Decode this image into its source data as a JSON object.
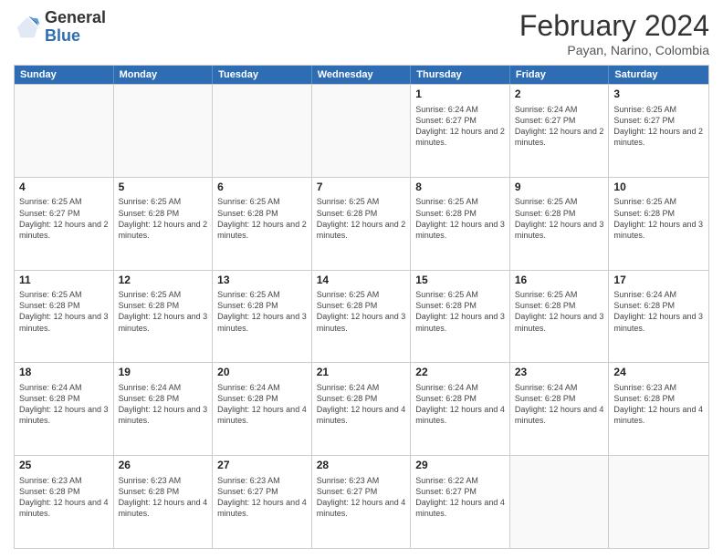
{
  "header": {
    "logo": {
      "line1": "General",
      "line2": "Blue"
    },
    "title": "February 2024",
    "location": "Payan, Narino, Colombia"
  },
  "days_of_week": [
    "Sunday",
    "Monday",
    "Tuesday",
    "Wednesday",
    "Thursday",
    "Friday",
    "Saturday"
  ],
  "weeks": [
    [
      {
        "day": "",
        "empty": true
      },
      {
        "day": "",
        "empty": true
      },
      {
        "day": "",
        "empty": true
      },
      {
        "day": "",
        "empty": true
      },
      {
        "day": "1",
        "sunrise": "Sunrise: 6:24 AM",
        "sunset": "Sunset: 6:27 PM",
        "daylight": "Daylight: 12 hours and 2 minutes."
      },
      {
        "day": "2",
        "sunrise": "Sunrise: 6:24 AM",
        "sunset": "Sunset: 6:27 PM",
        "daylight": "Daylight: 12 hours and 2 minutes."
      },
      {
        "day": "3",
        "sunrise": "Sunrise: 6:25 AM",
        "sunset": "Sunset: 6:27 PM",
        "daylight": "Daylight: 12 hours and 2 minutes."
      }
    ],
    [
      {
        "day": "4",
        "sunrise": "Sunrise: 6:25 AM",
        "sunset": "Sunset: 6:27 PM",
        "daylight": "Daylight: 12 hours and 2 minutes."
      },
      {
        "day": "5",
        "sunrise": "Sunrise: 6:25 AM",
        "sunset": "Sunset: 6:28 PM",
        "daylight": "Daylight: 12 hours and 2 minutes."
      },
      {
        "day": "6",
        "sunrise": "Sunrise: 6:25 AM",
        "sunset": "Sunset: 6:28 PM",
        "daylight": "Daylight: 12 hours and 2 minutes."
      },
      {
        "day": "7",
        "sunrise": "Sunrise: 6:25 AM",
        "sunset": "Sunset: 6:28 PM",
        "daylight": "Daylight: 12 hours and 2 minutes."
      },
      {
        "day": "8",
        "sunrise": "Sunrise: 6:25 AM",
        "sunset": "Sunset: 6:28 PM",
        "daylight": "Daylight: 12 hours and 3 minutes."
      },
      {
        "day": "9",
        "sunrise": "Sunrise: 6:25 AM",
        "sunset": "Sunset: 6:28 PM",
        "daylight": "Daylight: 12 hours and 3 minutes."
      },
      {
        "day": "10",
        "sunrise": "Sunrise: 6:25 AM",
        "sunset": "Sunset: 6:28 PM",
        "daylight": "Daylight: 12 hours and 3 minutes."
      }
    ],
    [
      {
        "day": "11",
        "sunrise": "Sunrise: 6:25 AM",
        "sunset": "Sunset: 6:28 PM",
        "daylight": "Daylight: 12 hours and 3 minutes."
      },
      {
        "day": "12",
        "sunrise": "Sunrise: 6:25 AM",
        "sunset": "Sunset: 6:28 PM",
        "daylight": "Daylight: 12 hours and 3 minutes."
      },
      {
        "day": "13",
        "sunrise": "Sunrise: 6:25 AM",
        "sunset": "Sunset: 6:28 PM",
        "daylight": "Daylight: 12 hours and 3 minutes."
      },
      {
        "day": "14",
        "sunrise": "Sunrise: 6:25 AM",
        "sunset": "Sunset: 6:28 PM",
        "daylight": "Daylight: 12 hours and 3 minutes."
      },
      {
        "day": "15",
        "sunrise": "Sunrise: 6:25 AM",
        "sunset": "Sunset: 6:28 PM",
        "daylight": "Daylight: 12 hours and 3 minutes."
      },
      {
        "day": "16",
        "sunrise": "Sunrise: 6:25 AM",
        "sunset": "Sunset: 6:28 PM",
        "daylight": "Daylight: 12 hours and 3 minutes."
      },
      {
        "day": "17",
        "sunrise": "Sunrise: 6:24 AM",
        "sunset": "Sunset: 6:28 PM",
        "daylight": "Daylight: 12 hours and 3 minutes."
      }
    ],
    [
      {
        "day": "18",
        "sunrise": "Sunrise: 6:24 AM",
        "sunset": "Sunset: 6:28 PM",
        "daylight": "Daylight: 12 hours and 3 minutes."
      },
      {
        "day": "19",
        "sunrise": "Sunrise: 6:24 AM",
        "sunset": "Sunset: 6:28 PM",
        "daylight": "Daylight: 12 hours and 3 minutes."
      },
      {
        "day": "20",
        "sunrise": "Sunrise: 6:24 AM",
        "sunset": "Sunset: 6:28 PM",
        "daylight": "Daylight: 12 hours and 4 minutes."
      },
      {
        "day": "21",
        "sunrise": "Sunrise: 6:24 AM",
        "sunset": "Sunset: 6:28 PM",
        "daylight": "Daylight: 12 hours and 4 minutes."
      },
      {
        "day": "22",
        "sunrise": "Sunrise: 6:24 AM",
        "sunset": "Sunset: 6:28 PM",
        "daylight": "Daylight: 12 hours and 4 minutes."
      },
      {
        "day": "23",
        "sunrise": "Sunrise: 6:24 AM",
        "sunset": "Sunset: 6:28 PM",
        "daylight": "Daylight: 12 hours and 4 minutes."
      },
      {
        "day": "24",
        "sunrise": "Sunrise: 6:23 AM",
        "sunset": "Sunset: 6:28 PM",
        "daylight": "Daylight: 12 hours and 4 minutes."
      }
    ],
    [
      {
        "day": "25",
        "sunrise": "Sunrise: 6:23 AM",
        "sunset": "Sunset: 6:28 PM",
        "daylight": "Daylight: 12 hours and 4 minutes."
      },
      {
        "day": "26",
        "sunrise": "Sunrise: 6:23 AM",
        "sunset": "Sunset: 6:28 PM",
        "daylight": "Daylight: 12 hours and 4 minutes."
      },
      {
        "day": "27",
        "sunrise": "Sunrise: 6:23 AM",
        "sunset": "Sunset: 6:27 PM",
        "daylight": "Daylight: 12 hours and 4 minutes."
      },
      {
        "day": "28",
        "sunrise": "Sunrise: 6:23 AM",
        "sunset": "Sunset: 6:27 PM",
        "daylight": "Daylight: 12 hours and 4 minutes."
      },
      {
        "day": "29",
        "sunrise": "Sunrise: 6:22 AM",
        "sunset": "Sunset: 6:27 PM",
        "daylight": "Daylight: 12 hours and 4 minutes."
      },
      {
        "day": "",
        "empty": true
      },
      {
        "day": "",
        "empty": true
      }
    ]
  ]
}
